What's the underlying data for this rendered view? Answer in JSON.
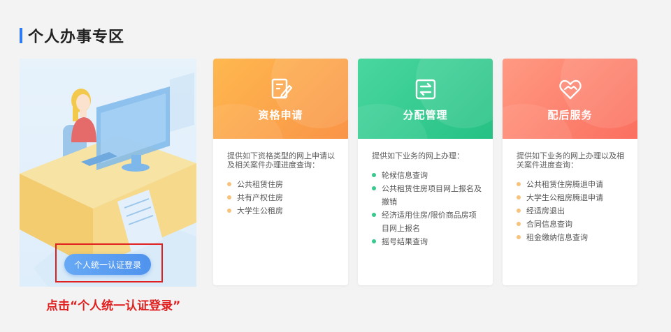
{
  "section": {
    "title": "个人办事专区"
  },
  "login": {
    "button_label": "个人统一认证登录"
  },
  "hint": {
    "text": "点击“个人统一认证登录”"
  },
  "colors": {
    "accent": "#2f7bf2",
    "qualification": "#f99447",
    "allocation": "#26c184",
    "after_service": "#fb6f5f",
    "hint_red": "#e01f1f"
  },
  "cards": [
    {
      "title": "资格申请",
      "icon": "form-edit-icon",
      "dot_color": "#f8c27a",
      "desc": "提供如下资格类型的网上申请以及相关案件办理进度查询：",
      "items": [
        "公共租赁住房",
        "共有产权住房",
        "大学生公租房"
      ]
    },
    {
      "title": "分配管理",
      "icon": "exchange-icon",
      "dot_color": "#39c88e",
      "desc": "提供如下业务的网上办理：",
      "items": [
        "轮候信息查询",
        "公共租赁住房项目网上报名及撤销",
        "经济适用住房/限价商品房项目网上报名",
        "摇号结果查询"
      ]
    },
    {
      "title": "配后服务",
      "icon": "heart-handshake-icon",
      "dot_color": "#f8c27a",
      "desc": "提供如下业务的网上办理以及相关案件进度查询：",
      "items": [
        "公共租赁住房腾退申请",
        "大学生公租房腾退申请",
        "经适房退出",
        "合同信息查询",
        "租金缴纳信息查询"
      ]
    }
  ]
}
